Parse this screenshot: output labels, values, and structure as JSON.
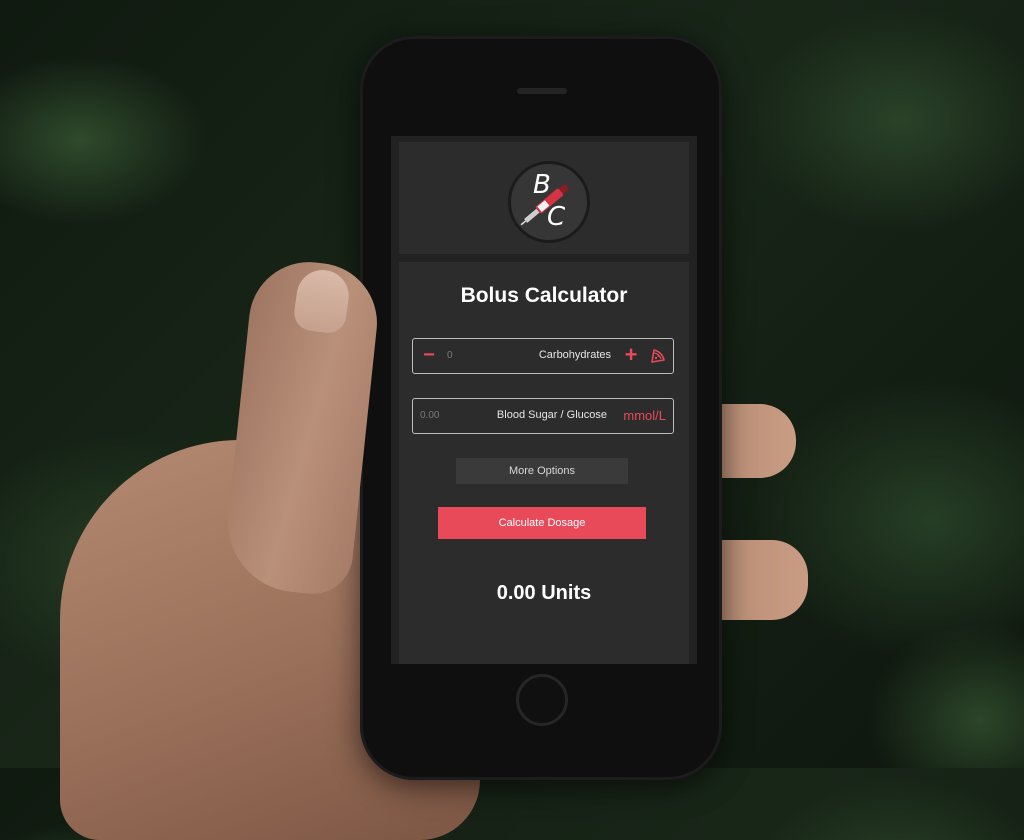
{
  "app": {
    "logo_letters": [
      "B",
      "C"
    ],
    "title": "Bolus Calculator"
  },
  "carbs": {
    "value": "0",
    "label": "Carbohydrates",
    "minus_symbol": "−",
    "plus_symbol": "+",
    "icon": "pizza-slice-icon"
  },
  "sugar": {
    "value": "0.00",
    "label": "Blood Sugar / Glucose",
    "unit": "mmol/L"
  },
  "buttons": {
    "more_options": "More Options",
    "calculate": "Calculate Dosage"
  },
  "result": {
    "text": "0.00 Units"
  },
  "colors": {
    "accent": "#e84a5a",
    "panel": "#2c2c2c",
    "screen_bg": "#222222",
    "button_gray": "#3a3a3a"
  }
}
